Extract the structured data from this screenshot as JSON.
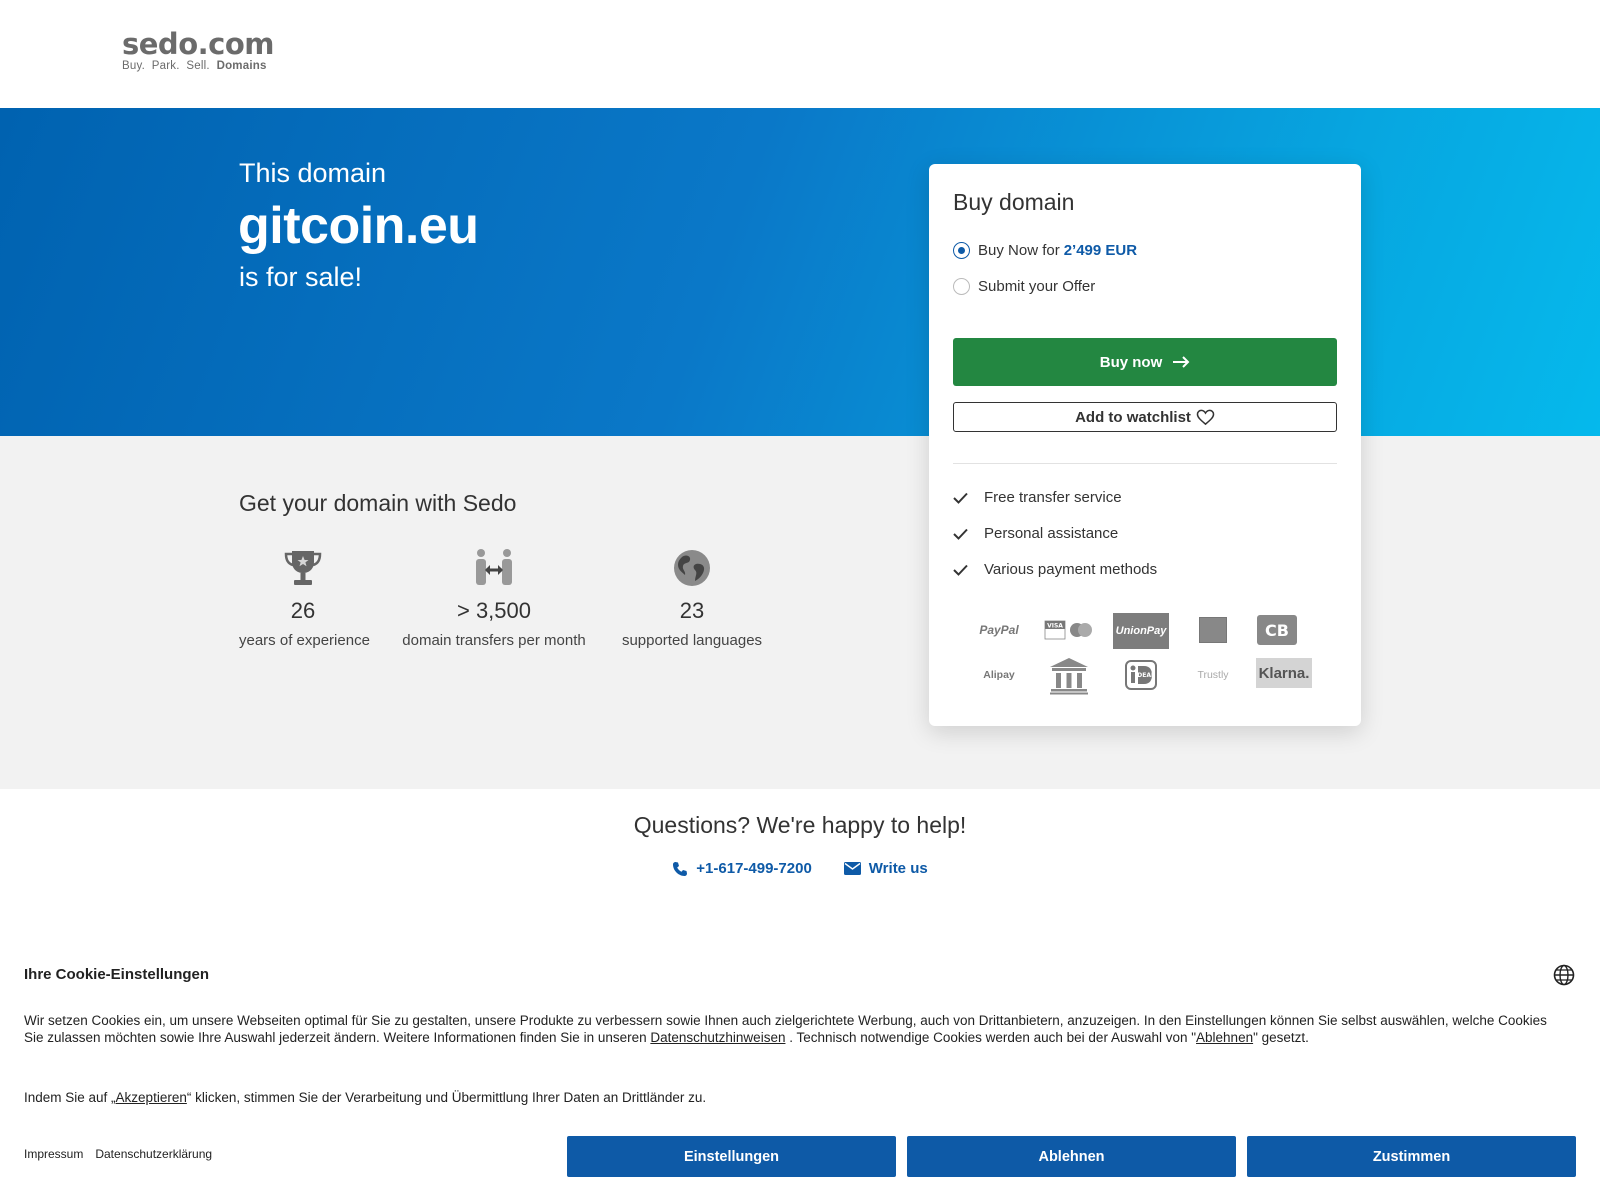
{
  "header": {
    "logo_main": "sedo.com",
    "logo_sub_1": "Buy.",
    "logo_sub_2": "Park.",
    "logo_sub_3": "Sell.",
    "logo_sub_4": "Domains"
  },
  "hero": {
    "pre": "This domain",
    "domain": "gitcoin.eu",
    "post": "is for sale!"
  },
  "stats_section": {
    "title": "Get your domain with Sedo",
    "stats": [
      {
        "icon": "trophy-icon",
        "value": "26",
        "label": "years of experience"
      },
      {
        "icon": "transfer-people-icon",
        "value": "> 3,500",
        "label": "domain transfers per month"
      },
      {
        "icon": "globe-icon",
        "value": "23",
        "label": "supported languages"
      }
    ]
  },
  "card": {
    "title": "Buy domain",
    "option_buy_label": "Buy Now for",
    "option_buy_price": "2’499 EUR",
    "option_offer_label": "Submit your Offer",
    "buy_button": "Buy now",
    "watchlist_button": "Add to watchlist",
    "features": [
      "Free transfer service",
      "Personal assistance",
      "Various payment methods"
    ],
    "payment_methods": [
      "PayPal",
      "Visa / Mastercard",
      "UnionPay",
      "American Express",
      "CB",
      "Alipay",
      "Bank transfer",
      "iDEAL",
      "Trustly",
      "Klarna."
    ]
  },
  "help": {
    "title": "Questions? We're happy to help!",
    "phone": "+1-617-499-7200",
    "write": "Write us"
  },
  "cookie": {
    "title": "Ihre Cookie-Einstellungen",
    "text_1": "Wir setzen Cookies ein, um unsere Webseiten optimal für Sie zu gestalten, unsere Produkte zu verbessern sowie Ihnen auch zielgerichtete Werbung, auch von Drittanbietern, anzuzeigen. In den Einstellungen können Sie selbst auswählen, welche Cookies Sie zulassen möchten sowie Ihre Auswahl jederzeit ändern. Weitere Informationen finden Sie in unseren",
    "link_privacy": "Datenschutzhinweisen",
    "text_2": ". Technisch notwendige Cookies werden auch bei der Auswahl von \"",
    "link_reject": "Ablehnen",
    "text_3": "\" gesetzt.",
    "text2_1": "Indem Sie auf „",
    "link_accept": "Akzeptieren",
    "text2_2": "“ klicken, stimmen Sie der Verarbeitung und Übermittlung Ihrer Daten an Drittländer zu.",
    "impressum": "Impressum",
    "datenschutz": "Datenschutzerklärung",
    "btn_settings": "Einstellungen",
    "btn_reject": "Ablehnen",
    "btn_accept": "Zustimmen"
  }
}
